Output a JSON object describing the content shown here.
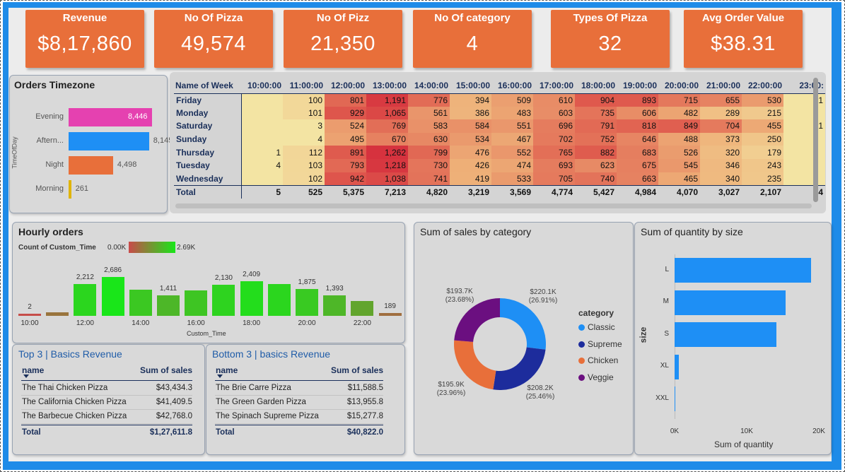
{
  "kpis": [
    {
      "title": "Revenue",
      "value": "$8,17,860"
    },
    {
      "title": "No Of Pizza",
      "value": "49,574"
    },
    {
      "title": "No Of Pizz",
      "value": "21,350"
    },
    {
      "title": "No Of category",
      "value": "4"
    },
    {
      "title": "Types Of Pizza",
      "value": "32"
    },
    {
      "title": "Avg Order Value",
      "value": "$38.31"
    }
  ],
  "timezone": {
    "title": "Orders Timezone",
    "axis_label": "TimeOfDay",
    "chart_data": {
      "type": "bar",
      "categories": [
        "Evening",
        "Aftern...",
        "Night",
        "Morning"
      ],
      "values": [
        8446,
        8145,
        4498,
        261
      ],
      "labels": [
        "8,446",
        "8,145",
        "4,498",
        "261"
      ],
      "colors": [
        "#e541b0",
        "#1e8ff5",
        "#e86f3a",
        "#e0b400"
      ]
    }
  },
  "heatmap": {
    "header": [
      "Name of Week",
      "10:00:00",
      "11:00:00",
      "12:00:00",
      "13:00:00",
      "14:00:00",
      "15:00:00",
      "16:00:00",
      "17:00:00",
      "18:00:00",
      "19:00:00",
      "20:00:00",
      "21:00:00",
      "22:00:00",
      "23:00:"
    ],
    "rows": [
      [
        "Friday",
        "",
        "100",
        "801",
        "1,191",
        "776",
        "394",
        "509",
        "610",
        "904",
        "893",
        "715",
        "655",
        "530",
        "1"
      ],
      [
        "Monday",
        "",
        "101",
        "929",
        "1,065",
        "561",
        "386",
        "483",
        "603",
        "735",
        "606",
        "482",
        "289",
        "215",
        ""
      ],
      [
        "Saturday",
        "",
        "3",
        "524",
        "769",
        "583",
        "584",
        "551",
        "696",
        "791",
        "818",
        "849",
        "704",
        "455",
        "1"
      ],
      [
        "Sunday",
        "",
        "4",
        "495",
        "670",
        "630",
        "534",
        "467",
        "702",
        "752",
        "646",
        "488",
        "373",
        "250",
        ""
      ],
      [
        "Thursday",
        "1",
        "112",
        "891",
        "1,262",
        "799",
        "476",
        "552",
        "765",
        "882",
        "683",
        "526",
        "320",
        "179",
        ""
      ],
      [
        "Tuesday",
        "4",
        "103",
        "793",
        "1,218",
        "730",
        "426",
        "474",
        "693",
        "623",
        "675",
        "545",
        "346",
        "243",
        ""
      ],
      [
        "Wednesday",
        "",
        "102",
        "942",
        "1,038",
        "741",
        "419",
        "533",
        "705",
        "740",
        "663",
        "465",
        "340",
        "235",
        ""
      ]
    ],
    "total": [
      "Total",
      "5",
      "525",
      "5,375",
      "7,213",
      "4,820",
      "3,219",
      "3,569",
      "4,774",
      "5,427",
      "4,984",
      "4,070",
      "3,027",
      "2,107",
      "4"
    ]
  },
  "hourly": {
    "title": "Hourly orders",
    "legend_label": "Count of Custom_Time",
    "legend_min": "0.00K",
    "legend_max": "2.69K",
    "xlabel": "Custom_Time",
    "chart_data": {
      "type": "bar",
      "x_ticks": [
        "10:00",
        "12:00",
        "14:00",
        "16:00",
        "18:00",
        "20:00",
        "22:00"
      ],
      "values": [
        2,
        250,
        2212,
        2686,
        1820,
        1411,
        1750,
        2130,
        2409,
        2200,
        1875,
        1393,
        1010,
        189
      ],
      "labels": [
        "2",
        "",
        "2,212",
        "2,686",
        "",
        "1,411",
        "",
        "2,130",
        "2,409",
        "",
        "1,875",
        "1,393",
        "",
        "189"
      ]
    }
  },
  "top3": {
    "title": "Top 3 | Basics Revenue",
    "col_name": "name",
    "col_sales": "Sum of sales",
    "rows": [
      [
        "The Thai Chicken Pizza",
        "$43,434.3"
      ],
      [
        "The California Chicken Pizza",
        "$41,409.5"
      ],
      [
        "The Barbecue Chicken Pizza",
        "$42,768.0"
      ]
    ],
    "total": [
      "Total",
      "$1,27,611.8"
    ]
  },
  "bottom3": {
    "title": "Bottom 3 | basics Revenue",
    "col_name": "name",
    "col_sales": "Sum of sales",
    "rows": [
      [
        "The Brie Carre Pizza",
        "$11,588.5"
      ],
      [
        "The Green Garden Pizza",
        "$13,955.8"
      ],
      [
        "The Spinach Supreme Pizza",
        "$15,277.8"
      ]
    ],
    "total": [
      "Total",
      "$40,822.0"
    ]
  },
  "category": {
    "title": "Sum of sales by category",
    "legend_title": "category",
    "chart_data": {
      "type": "pie",
      "categories": [
        "Classic",
        "Supreme",
        "Chicken",
        "Veggie"
      ],
      "values": [
        220.1,
        208.2,
        195.9,
        193.7
      ],
      "labels": [
        [
          "$220.1K",
          "(26.91%)"
        ],
        [
          "$208.2K",
          "(25.46%)"
        ],
        [
          "$195.9K",
          "(23.96%)"
        ],
        [
          "$193.7K",
          "(23.68%)"
        ]
      ],
      "colors": [
        "#1e8ff5",
        "#1d2c9c",
        "#e86f3a",
        "#6b0f80"
      ]
    }
  },
  "size": {
    "title": "Sum of quantity by size",
    "xlabel": "Sum of quantity",
    "ylabel": "size",
    "chart_data": {
      "type": "bar",
      "categories": [
        "L",
        "M",
        "S",
        "XL",
        "XXL"
      ],
      "values": [
        18956,
        15385,
        14137,
        552,
        28
      ],
      "x_ticks": [
        "0K",
        "10K",
        "20K"
      ],
      "xlim": [
        0,
        20000
      ]
    }
  }
}
